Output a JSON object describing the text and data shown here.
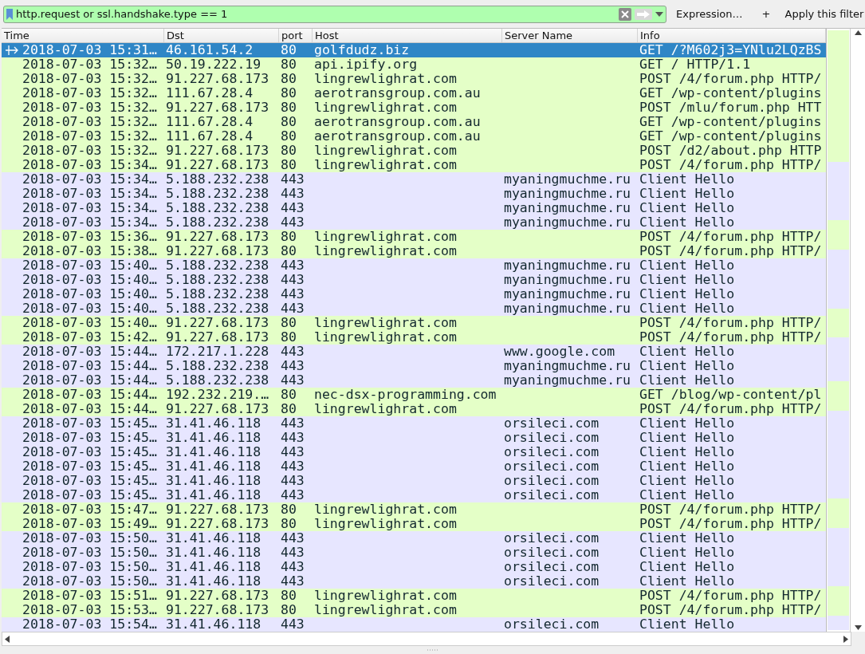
{
  "filter_bar": {
    "value": "http.request or ssl.handshake.type == 1",
    "expression_button": "Expression…",
    "add_button": "+",
    "apply_label": "Apply this filter"
  },
  "table": {
    "columns": [
      "Time",
      "Dst",
      "port",
      "Host",
      "Server Name",
      "Info"
    ],
    "rows": [
      {
        "kind": "http",
        "selected": true,
        "cells": [
          "2018-07-03 15:31…",
          "46.161.54.2",
          "80",
          "golfdudz.biz",
          "",
          "GET /?M602j3=YNlu2LQzBS"
        ]
      },
      {
        "kind": "http",
        "selected": false,
        "cells": [
          "2018-07-03 15:32…",
          "50.19.222.19",
          "80",
          "api.ipify.org",
          "",
          "GET / HTTP/1.1"
        ]
      },
      {
        "kind": "http",
        "selected": false,
        "cells": [
          "2018-07-03 15:32…",
          "91.227.68.173",
          "80",
          "lingrewlighrat.com",
          "",
          "POST /4/forum.php HTTP/"
        ]
      },
      {
        "kind": "http",
        "selected": false,
        "cells": [
          "2018-07-03 15:32…",
          "111.67.28.4",
          "80",
          "aerotransgroup.com.au",
          "",
          "GET /wp-content/plugins"
        ]
      },
      {
        "kind": "http",
        "selected": false,
        "cells": [
          "2018-07-03 15:32…",
          "91.227.68.173",
          "80",
          "lingrewlighrat.com",
          "",
          "POST /mlu/forum.php HTT"
        ]
      },
      {
        "kind": "http",
        "selected": false,
        "cells": [
          "2018-07-03 15:32…",
          "111.67.28.4",
          "80",
          "aerotransgroup.com.au",
          "",
          "GET /wp-content/plugins"
        ]
      },
      {
        "kind": "http",
        "selected": false,
        "cells": [
          "2018-07-03 15:32…",
          "111.67.28.4",
          "80",
          "aerotransgroup.com.au",
          "",
          "GET /wp-content/plugins"
        ]
      },
      {
        "kind": "http",
        "selected": false,
        "cells": [
          "2018-07-03 15:32…",
          "91.227.68.173",
          "80",
          "lingrewlighrat.com",
          "",
          "POST /d2/about.php HTTP"
        ]
      },
      {
        "kind": "http",
        "selected": false,
        "cells": [
          "2018-07-03 15:34…",
          "91.227.68.173",
          "80",
          "lingrewlighrat.com",
          "",
          "POST /4/forum.php HTTP/"
        ]
      },
      {
        "kind": "tls",
        "selected": false,
        "cells": [
          "2018-07-03 15:34…",
          "5.188.232.238",
          "443",
          "",
          "myaningmuchme.ru",
          "Client Hello"
        ]
      },
      {
        "kind": "tls",
        "selected": false,
        "cells": [
          "2018-07-03 15:34…",
          "5.188.232.238",
          "443",
          "",
          "myaningmuchme.ru",
          "Client Hello"
        ]
      },
      {
        "kind": "tls",
        "selected": false,
        "cells": [
          "2018-07-03 15:34…",
          "5.188.232.238",
          "443",
          "",
          "myaningmuchme.ru",
          "Client Hello"
        ]
      },
      {
        "kind": "tls",
        "selected": false,
        "cells": [
          "2018-07-03 15:34…",
          "5.188.232.238",
          "443",
          "",
          "myaningmuchme.ru",
          "Client Hello"
        ]
      },
      {
        "kind": "http",
        "selected": false,
        "cells": [
          "2018-07-03 15:36…",
          "91.227.68.173",
          "80",
          "lingrewlighrat.com",
          "",
          "POST /4/forum.php HTTP/"
        ]
      },
      {
        "kind": "http",
        "selected": false,
        "cells": [
          "2018-07-03 15:38…",
          "91.227.68.173",
          "80",
          "lingrewlighrat.com",
          "",
          "POST /4/forum.php HTTP/"
        ]
      },
      {
        "kind": "tls",
        "selected": false,
        "cells": [
          "2018-07-03 15:40…",
          "5.188.232.238",
          "443",
          "",
          "myaningmuchme.ru",
          "Client Hello"
        ]
      },
      {
        "kind": "tls",
        "selected": false,
        "cells": [
          "2018-07-03 15:40…",
          "5.188.232.238",
          "443",
          "",
          "myaningmuchme.ru",
          "Client Hello"
        ]
      },
      {
        "kind": "tls",
        "selected": false,
        "cells": [
          "2018-07-03 15:40…",
          "5.188.232.238",
          "443",
          "",
          "myaningmuchme.ru",
          "Client Hello"
        ]
      },
      {
        "kind": "tls",
        "selected": false,
        "cells": [
          "2018-07-03 15:40…",
          "5.188.232.238",
          "443",
          "",
          "myaningmuchme.ru",
          "Client Hello"
        ]
      },
      {
        "kind": "http",
        "selected": false,
        "cells": [
          "2018-07-03 15:40…",
          "91.227.68.173",
          "80",
          "lingrewlighrat.com",
          "",
          "POST /4/forum.php HTTP/"
        ]
      },
      {
        "kind": "http",
        "selected": false,
        "cells": [
          "2018-07-03 15:42…",
          "91.227.68.173",
          "80",
          "lingrewlighrat.com",
          "",
          "POST /4/forum.php HTTP/"
        ]
      },
      {
        "kind": "tls",
        "selected": false,
        "cells": [
          "2018-07-03 15:44…",
          "172.217.1.228",
          "443",
          "",
          "www.google.com",
          "Client Hello"
        ]
      },
      {
        "kind": "tls",
        "selected": false,
        "cells": [
          "2018-07-03 15:44…",
          "5.188.232.238",
          "443",
          "",
          "myaningmuchme.ru",
          "Client Hello"
        ]
      },
      {
        "kind": "tls",
        "selected": false,
        "cells": [
          "2018-07-03 15:44…",
          "5.188.232.238",
          "443",
          "",
          "myaningmuchme.ru",
          "Client Hello"
        ]
      },
      {
        "kind": "http",
        "selected": false,
        "cells": [
          "2018-07-03 15:44…",
          "192.232.219.…",
          "80",
          "nec-dsx-programming.com",
          "",
          "GET /blog/wp-content/pl"
        ]
      },
      {
        "kind": "http",
        "selected": false,
        "cells": [
          "2018-07-03 15:44…",
          "91.227.68.173",
          "80",
          "lingrewlighrat.com",
          "",
          "POST /4/forum.php HTTP/"
        ]
      },
      {
        "kind": "tls",
        "selected": false,
        "cells": [
          "2018-07-03 15:45…",
          "31.41.46.118",
          "443",
          "",
          "orsileci.com",
          "Client Hello"
        ]
      },
      {
        "kind": "tls",
        "selected": false,
        "cells": [
          "2018-07-03 15:45…",
          "31.41.46.118",
          "443",
          "",
          "orsileci.com",
          "Client Hello"
        ]
      },
      {
        "kind": "tls",
        "selected": false,
        "cells": [
          "2018-07-03 15:45…",
          "31.41.46.118",
          "443",
          "",
          "orsileci.com",
          "Client Hello"
        ]
      },
      {
        "kind": "tls",
        "selected": false,
        "cells": [
          "2018-07-03 15:45…",
          "31.41.46.118",
          "443",
          "",
          "orsileci.com",
          "Client Hello"
        ]
      },
      {
        "kind": "tls",
        "selected": false,
        "cells": [
          "2018-07-03 15:45…",
          "31.41.46.118",
          "443",
          "",
          "orsileci.com",
          "Client Hello"
        ]
      },
      {
        "kind": "tls",
        "selected": false,
        "cells": [
          "2018-07-03 15:45…",
          "31.41.46.118",
          "443",
          "",
          "orsileci.com",
          "Client Hello"
        ]
      },
      {
        "kind": "http",
        "selected": false,
        "cells": [
          "2018-07-03 15:47…",
          "91.227.68.173",
          "80",
          "lingrewlighrat.com",
          "",
          "POST /4/forum.php HTTP/"
        ]
      },
      {
        "kind": "http",
        "selected": false,
        "cells": [
          "2018-07-03 15:49…",
          "91.227.68.173",
          "80",
          "lingrewlighrat.com",
          "",
          "POST /4/forum.php HTTP/"
        ]
      },
      {
        "kind": "tls",
        "selected": false,
        "cells": [
          "2018-07-03 15:50…",
          "31.41.46.118",
          "443",
          "",
          "orsileci.com",
          "Client Hello"
        ]
      },
      {
        "kind": "tls",
        "selected": false,
        "cells": [
          "2018-07-03 15:50…",
          "31.41.46.118",
          "443",
          "",
          "orsileci.com",
          "Client Hello"
        ]
      },
      {
        "kind": "tls",
        "selected": false,
        "cells": [
          "2018-07-03 15:50…",
          "31.41.46.118",
          "443",
          "",
          "orsileci.com",
          "Client Hello"
        ]
      },
      {
        "kind": "tls",
        "selected": false,
        "cells": [
          "2018-07-03 15:50…",
          "31.41.46.118",
          "443",
          "",
          "orsileci.com",
          "Client Hello"
        ]
      },
      {
        "kind": "http",
        "selected": false,
        "cells": [
          "2018-07-03 15:51…",
          "91.227.68.173",
          "80",
          "lingrewlighrat.com",
          "",
          "POST /4/forum.php HTTP/"
        ]
      },
      {
        "kind": "http",
        "selected": false,
        "cells": [
          "2018-07-03 15:53…",
          "91.227.68.173",
          "80",
          "lingrewlighrat.com",
          "",
          "POST /4/forum.php HTTP/"
        ]
      },
      {
        "kind": "tls",
        "selected": false,
        "cells": [
          "2018-07-03 15:54…",
          "31.41.46.118",
          "443",
          "",
          "orsileci.com",
          "Client Hello"
        ]
      }
    ]
  }
}
